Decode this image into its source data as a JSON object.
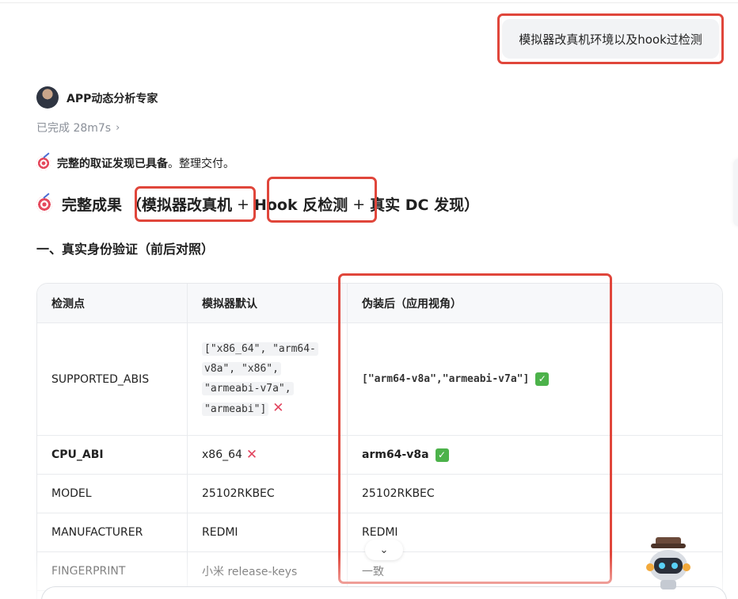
{
  "user_message": "模拟器改真机环境以及hook过检测",
  "agent": {
    "name": "APP动态分析专家",
    "status": "已完成 28m7s",
    "status_chevron": "chevron-right-icon"
  },
  "intro": {
    "bold": "完整的取证发现已具备",
    "rest": "。整理交付。"
  },
  "heading": {
    "prefix": "完整成果",
    "part1": "（模拟器改真机",
    "plus1": "+",
    "part2": "Hook 反检测",
    "plus2": "+",
    "part3": "真实 DC 发现）"
  },
  "section_title": "一、真实身份验证（前后对照）",
  "table": {
    "headers": [
      "检测点",
      "模拟器默认",
      "伪装后（应用视角）"
    ],
    "rows": [
      {
        "point": "SUPPORTED_ABIS",
        "default_lines": [
          "[\"x86_64\", \"arm64-",
          "v8a\", \"x86\",",
          "\"armeabi-v7a\",",
          "\"armeabi\"]"
        ],
        "after": "[\"arm64-v8a\",\"armeabi-v7a\"]"
      },
      {
        "point": "CPU_ABI",
        "default": "x86_64",
        "after": "arm64-v8a"
      },
      {
        "point": "MODEL",
        "default": "25102RKBEC",
        "after": "25102RKBEC"
      },
      {
        "point": "MANUFACTURER",
        "default": "REDMI",
        "after": "REDMI"
      },
      {
        "point": "FINGERPRINT",
        "default": "小米 release-keys",
        "after": "一致"
      }
    ]
  },
  "colors": {
    "highlight": "#e0463b",
    "cross": "#e2455f",
    "check": "#4cb24a"
  }
}
